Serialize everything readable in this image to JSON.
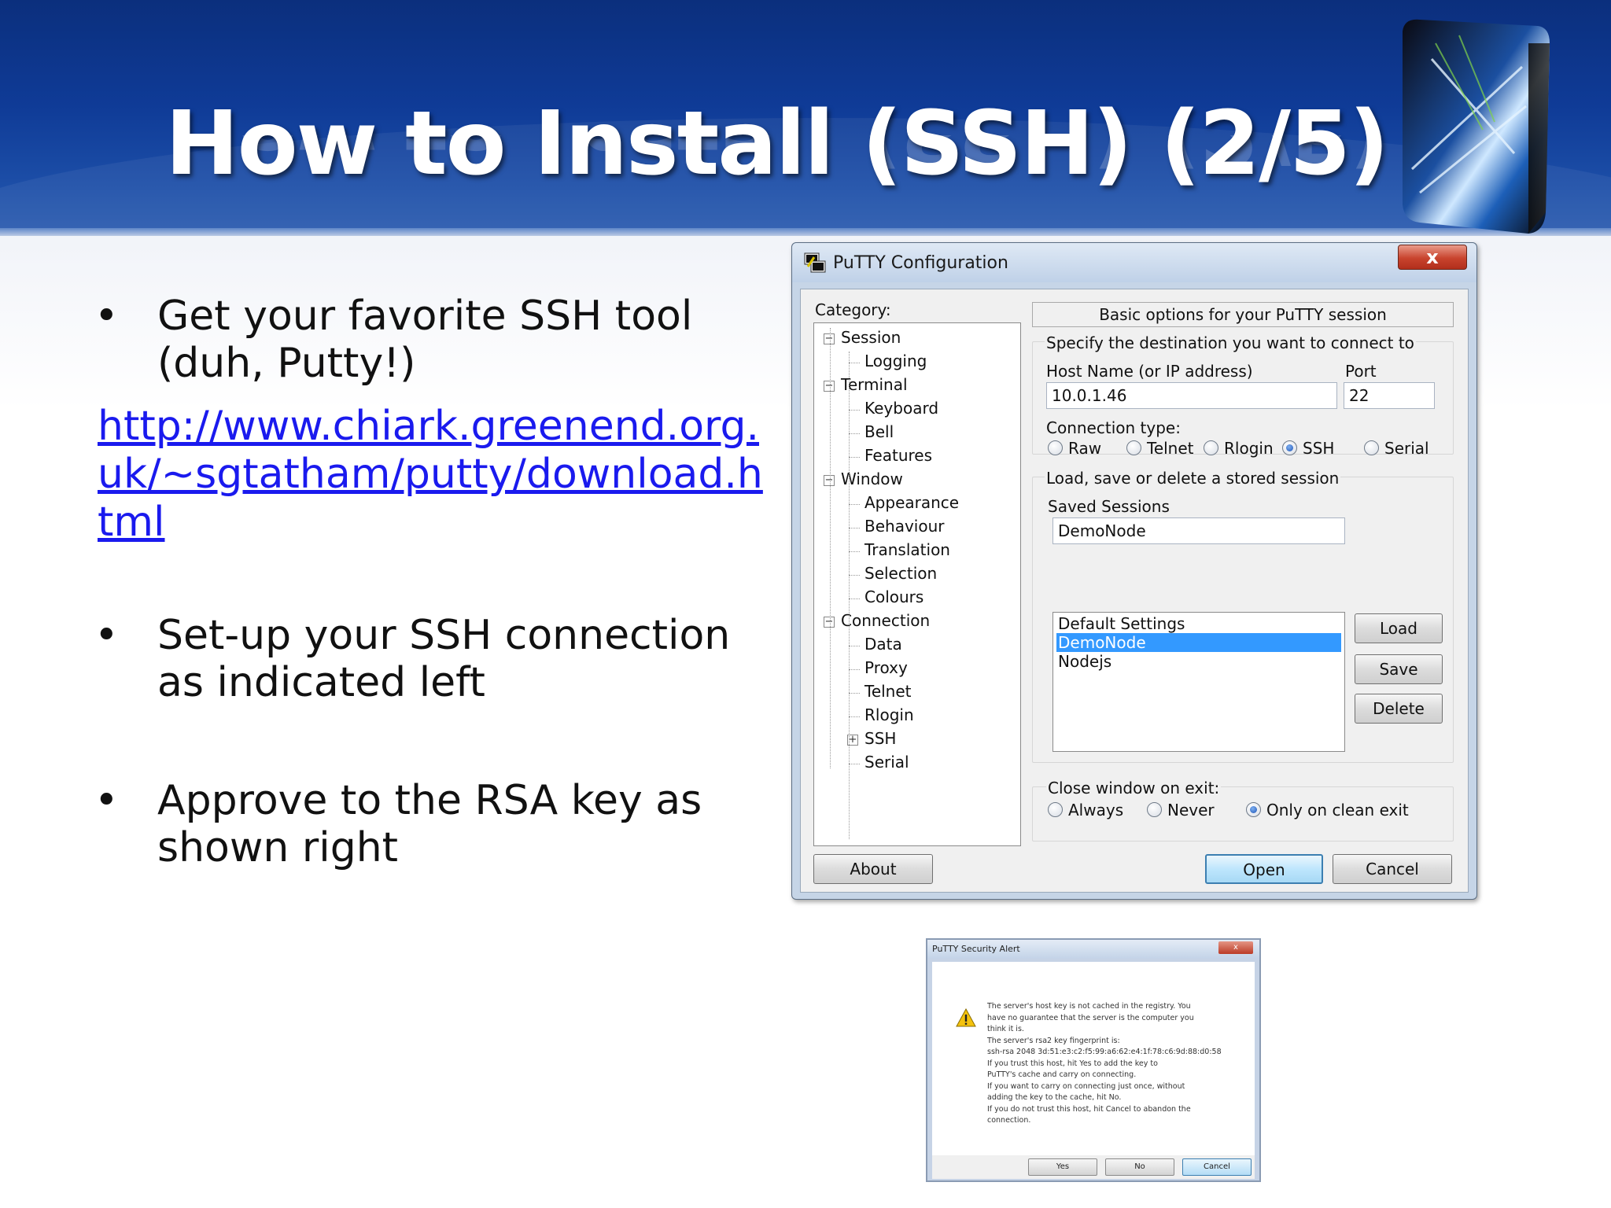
{
  "slide": {
    "title": "How to Install (SSH) (2/5)",
    "bullets": [
      "Get your favorite SSH tool (duh, Putty!)",
      "Set-up your SSH connection as indicated left",
      "Approve to the RSA key as shown right"
    ],
    "bullet_marker": "•",
    "link": "http://www.chiark.greenend.org.uk/~sgtatham/putty/download.html"
  },
  "putty": {
    "title": "PuTTY Configuration",
    "close_label": "x",
    "category_label": "Category:",
    "tree": [
      {
        "label": "Session",
        "level": 0,
        "expander": "−"
      },
      {
        "label": "Logging",
        "level": 1
      },
      {
        "label": "Terminal",
        "level": 0,
        "expander": "−"
      },
      {
        "label": "Keyboard",
        "level": 1
      },
      {
        "label": "Bell",
        "level": 1
      },
      {
        "label": "Features",
        "level": 1
      },
      {
        "label": "Window",
        "level": 0,
        "expander": "−"
      },
      {
        "label": "Appearance",
        "level": 1
      },
      {
        "label": "Behaviour",
        "level": 1
      },
      {
        "label": "Translation",
        "level": 1
      },
      {
        "label": "Selection",
        "level": 1
      },
      {
        "label": "Colours",
        "level": 1
      },
      {
        "label": "Connection",
        "level": 0,
        "expander": "−"
      },
      {
        "label": "Data",
        "level": 1
      },
      {
        "label": "Proxy",
        "level": 1
      },
      {
        "label": "Telnet",
        "level": 1
      },
      {
        "label": "Rlogin",
        "level": 1
      },
      {
        "label": "SSH",
        "level": 1,
        "expander": "+"
      },
      {
        "label": "Serial",
        "level": 1
      }
    ],
    "panel_title": "Basic options for your PuTTY session",
    "destination_label": "Specify the destination you want to connect to",
    "host_label": "Host Name (or IP address)",
    "port_label": "Port",
    "host_value": "10.0.1.46",
    "port_value": "22",
    "conn_type_label": "Connection type:",
    "conn_types": [
      "Raw",
      "Telnet",
      "Rlogin",
      "SSH",
      "Serial"
    ],
    "conn_selected": "SSH",
    "sessions_group_label": "Load, save or delete a stored session",
    "saved_sessions_label": "Saved Sessions",
    "saved_sessions_value": "DemoNode",
    "sessions_list": [
      "Default Settings",
      "DemoNode",
      "Nodejs"
    ],
    "sessions_selected": "DemoNode",
    "load_label": "Load",
    "save_label": "Save",
    "delete_label": "Delete",
    "close_on_exit_label": "Close window on exit:",
    "exit_options": [
      "Always",
      "Never",
      "Only on clean exit"
    ],
    "exit_selected": "Only on clean exit",
    "about_label": "About",
    "open_label": "Open",
    "cancel_label": "Cancel"
  },
  "alert": {
    "title": "PuTTY Security Alert",
    "close_label": "x",
    "lines": [
      "The server's host key is not cached in the registry. You",
      "have no guarantee that the server is the computer you",
      "think it is.",
      "The server's rsa2 key fingerprint is:",
      "ssh-rsa 2048 3d:51:e3:c2:f5:99:a6:62:e4:1f:78:c6:9d:88:d0:58",
      "If you trust this host, hit Yes to add the key to",
      "PuTTY's cache and carry on connecting.",
      "If you want to carry on connecting just once, without",
      "adding the key to the cache, hit No.",
      "If you do not trust this host, hit Cancel to abandon the",
      "connection."
    ],
    "yes_label": "Yes",
    "no_label": "No",
    "cancel_label": "Cancel"
  },
  "colors": {
    "banner": "#0f3b97",
    "link": "#1a1aee",
    "selection": "#3399ff"
  },
  "icons": [
    "putty-app-icon",
    "warning-icon",
    "logo-cube"
  ]
}
